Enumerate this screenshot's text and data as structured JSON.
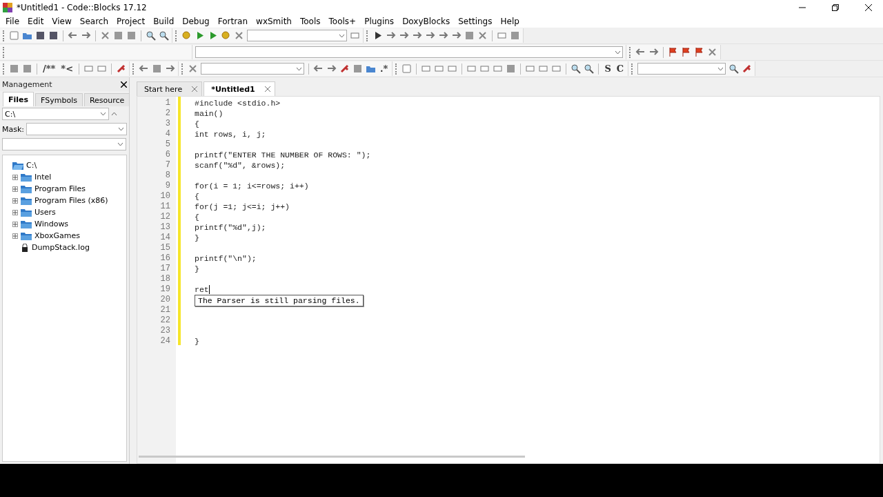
{
  "window": {
    "title": "*Untitled1 - Code::Blocks 17.12"
  },
  "menu": [
    "File",
    "Edit",
    "View",
    "Search",
    "Project",
    "Build",
    "Debug",
    "Fortran",
    "wxSmith",
    "Tools",
    "Tools+",
    "Plugins",
    "DoxyBlocks",
    "Settings",
    "Help"
  ],
  "toolbar_texts": {
    "doc_comment": "/**",
    "line_comment": "*<",
    "strip_s": "S",
    "strip_c": "C",
    "regex": ".*"
  },
  "management": {
    "title": "Management",
    "tabs": [
      {
        "label": "Files",
        "selected": true
      },
      {
        "label": "FSymbols",
        "selected": false
      },
      {
        "label": "Resource",
        "selected": false
      }
    ],
    "path": "C:\\",
    "mask_label": "Mask:",
    "tree": [
      {
        "label": "C:\\",
        "kind": "folder",
        "expanded": true,
        "children": [
          {
            "label": "Intel",
            "kind": "folder",
            "expanded": false
          },
          {
            "label": "Program Files",
            "kind": "folder",
            "expanded": false
          },
          {
            "label": "Program Files (x86)",
            "kind": "folder",
            "expanded": false
          },
          {
            "label": "Users",
            "kind": "folder",
            "expanded": false
          },
          {
            "label": "Windows",
            "kind": "folder",
            "expanded": false
          },
          {
            "label": "XboxGames",
            "kind": "folder",
            "expanded": false
          },
          {
            "label": "DumpStack.log",
            "kind": "file"
          }
        ]
      }
    ]
  },
  "editor": {
    "tabs": [
      {
        "label": "Start here",
        "selected": false
      },
      {
        "label": "*Untitled1",
        "selected": true
      }
    ],
    "lines": [
      {
        "number": "1",
        "text": "#include <stdio.h>"
      },
      {
        "number": "2",
        "text": "main()"
      },
      {
        "number": "3",
        "text": "{"
      },
      {
        "number": "4",
        "text": "int rows, i, j;"
      },
      {
        "number": "5"
      },
      {
        "number": "6",
        "text": "printf(\"ENTER THE NUMBER OF ROWS: \");"
      },
      {
        "number": "7",
        "text": "scanf(\"%d\", &rows);"
      },
      {
        "number": "8"
      },
      {
        "number": "9",
        "text": "for(i = 1; i<=rows; i++)"
      },
      {
        "number": "10",
        "text": "{"
      },
      {
        "number": "11",
        "text": "for(j =1; j<=i; j++)"
      },
      {
        "number": "12",
        "text": "{"
      },
      {
        "number": "13",
        "text": "printf(\"%d\",j);"
      },
      {
        "number": "14",
        "text": "}"
      },
      {
        "number": "15"
      },
      {
        "number": "16",
        "text": "printf(\"\\n\");"
      },
      {
        "number": "17",
        "text": "}"
      },
      {
        "number": "18"
      },
      {
        "number": "19",
        "text": "ret",
        "cursor": true
      },
      {
        "number": "20"
      },
      {
        "number": "21"
      },
      {
        "number": "22"
      },
      {
        "number": "23"
      },
      {
        "number": "24",
        "text": "}"
      }
    ],
    "tooltip": "The Parser is still parsing files."
  }
}
